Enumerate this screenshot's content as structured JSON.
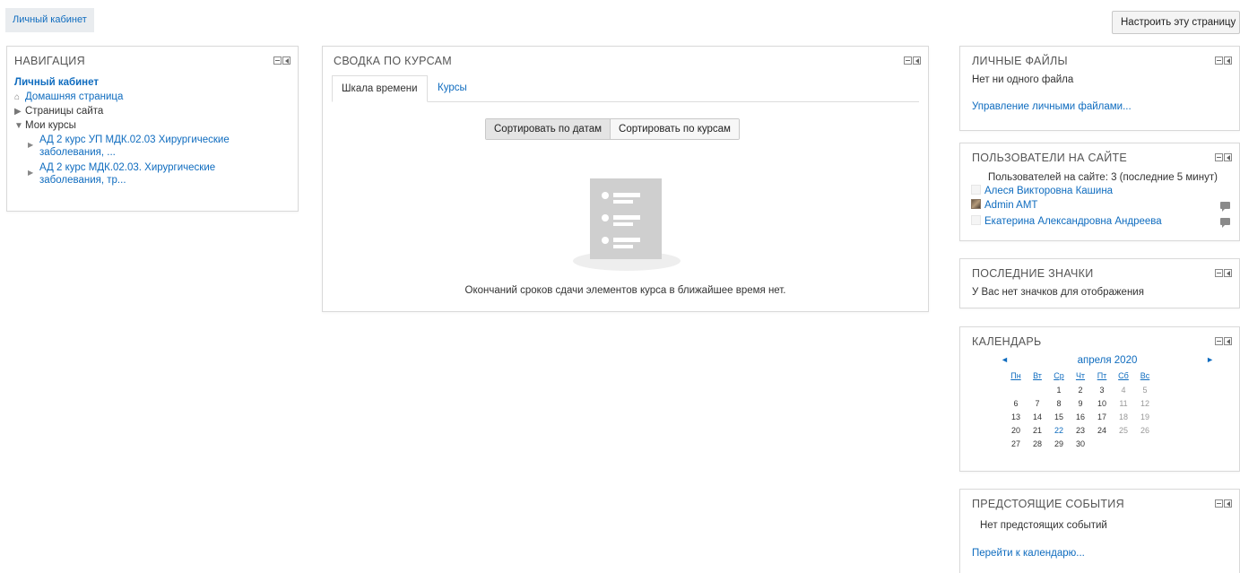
{
  "breadcrumb": {
    "label": "Личный кабинет"
  },
  "customize_button": "Настроить эту страницу",
  "navigation": {
    "title": "НАВИГАЦИЯ",
    "dashboard": "Личный кабинет",
    "home": "Домашняя страница",
    "site_pages": "Страницы сайта",
    "my_courses": "Мои курсы",
    "courses": [
      {
        "line1": "АД 2 курс УП МДК.02.03 Хирургические",
        "line2": "заболевания, ..."
      },
      {
        "line1": "АД 2 курс МДК.02.03. Хирургические",
        "line2": "заболевания, тр..."
      }
    ]
  },
  "course_overview": {
    "title": "СВОДКА ПО КУРСАМ",
    "tabs": [
      {
        "label": "Шкала времени"
      },
      {
        "label": "Курсы"
      }
    ],
    "sort_by_dates": "Сортировать по датам",
    "sort_by_courses": "Сортировать по курсам",
    "empty_message": "Окончаний сроков сдачи элементов курса в ближайшее время нет."
  },
  "private_files": {
    "title": "ЛИЧНЫЕ ФАЙЛЫ",
    "empty": "Нет ни одного файла",
    "manage_link": "Управление личными файлами..."
  },
  "online_users": {
    "title": "ПОЛЬЗОВАТЕЛИ НА САЙТЕ",
    "summary": "Пользователей на сайте: 3 (последние 5 минут)",
    "users": [
      {
        "name": "Алеся Викторовна Кашина"
      },
      {
        "name": "Admin AMT"
      },
      {
        "name": "Екатерина Александровна Андреева"
      }
    ]
  },
  "latest_badges": {
    "title": "ПОСЛЕДНИЕ ЗНАЧКИ",
    "empty": "У Вас нет значков для отображения"
  },
  "calendar": {
    "title": "КАЛЕНДАРЬ",
    "prev": "◄",
    "next": "►",
    "month": "апреля 2020",
    "weekdays": [
      "Пн",
      "Вт",
      "Ср",
      "Чт",
      "Пт",
      "Сб",
      "Вс"
    ],
    "weeks": [
      [
        "",
        "",
        "1",
        "2",
        "3",
        "4",
        "5"
      ],
      [
        "6",
        "7",
        "8",
        "9",
        "10",
        "11",
        "12"
      ],
      [
        "13",
        "14",
        "15",
        "16",
        "17",
        "18",
        "19"
      ],
      [
        "20",
        "21",
        "22",
        "23",
        "24",
        "25",
        "26"
      ],
      [
        "27",
        "28",
        "29",
        "30",
        "",
        "",
        ""
      ]
    ],
    "today": "22"
  },
  "upcoming_events": {
    "title": "ПРЕДСТОЯЩИЕ СОБЫТИЯ",
    "empty": "Нет предстоящих событий",
    "goto_link": "Перейти к календарю..."
  }
}
